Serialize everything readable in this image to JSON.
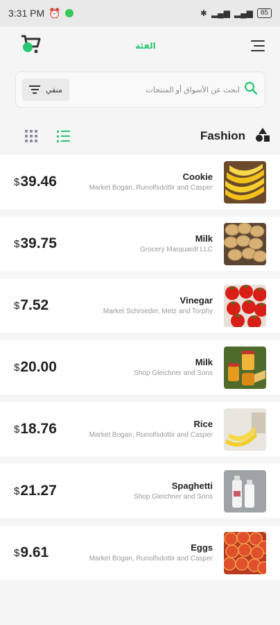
{
  "status_bar": {
    "time": "3:31 PM",
    "battery": "85"
  },
  "header": {
    "title": "الفئة"
  },
  "search": {
    "placeholder": "ابحث عن الأسواق أو المنتجات",
    "filter_label": "منقي"
  },
  "category": {
    "name": "Fashion"
  },
  "colors": {
    "accent": "#28c76f",
    "text": "#222222",
    "muted": "#9a9a9a"
  },
  "products": [
    {
      "name": "Cookie",
      "shop": "Market Bogan, Runolfsdottir and Casper",
      "currency": "$",
      "price": "39.46",
      "image": "bananas"
    },
    {
      "name": "Milk",
      "shop": "Grocery Marquardt LLC",
      "currency": "$",
      "price": "39.75",
      "image": "potatoes"
    },
    {
      "name": "Vinegar",
      "shop": "Market Schroeder, Metz and Torphy",
      "currency": "$",
      "price": "7.52",
      "image": "tomatoes"
    },
    {
      "name": "Milk",
      "shop": "Shop Gleichner and Sons",
      "currency": "$",
      "price": "20.00",
      "image": "honey-jars"
    },
    {
      "name": "Rice",
      "shop": "Market Bogan, Runolfsdottir and Casper",
      "currency": "$",
      "price": "18.76",
      "image": "bananas-table"
    },
    {
      "name": "Spaghetti",
      "shop": "Shop Gleichner and Sons",
      "currency": "$",
      "price": "21.27",
      "image": "milk-bottles"
    },
    {
      "name": "Eggs",
      "shop": "Market Bogan, Runolfsdottir and Casper",
      "currency": "$",
      "price": "9.61",
      "image": "apples"
    }
  ]
}
